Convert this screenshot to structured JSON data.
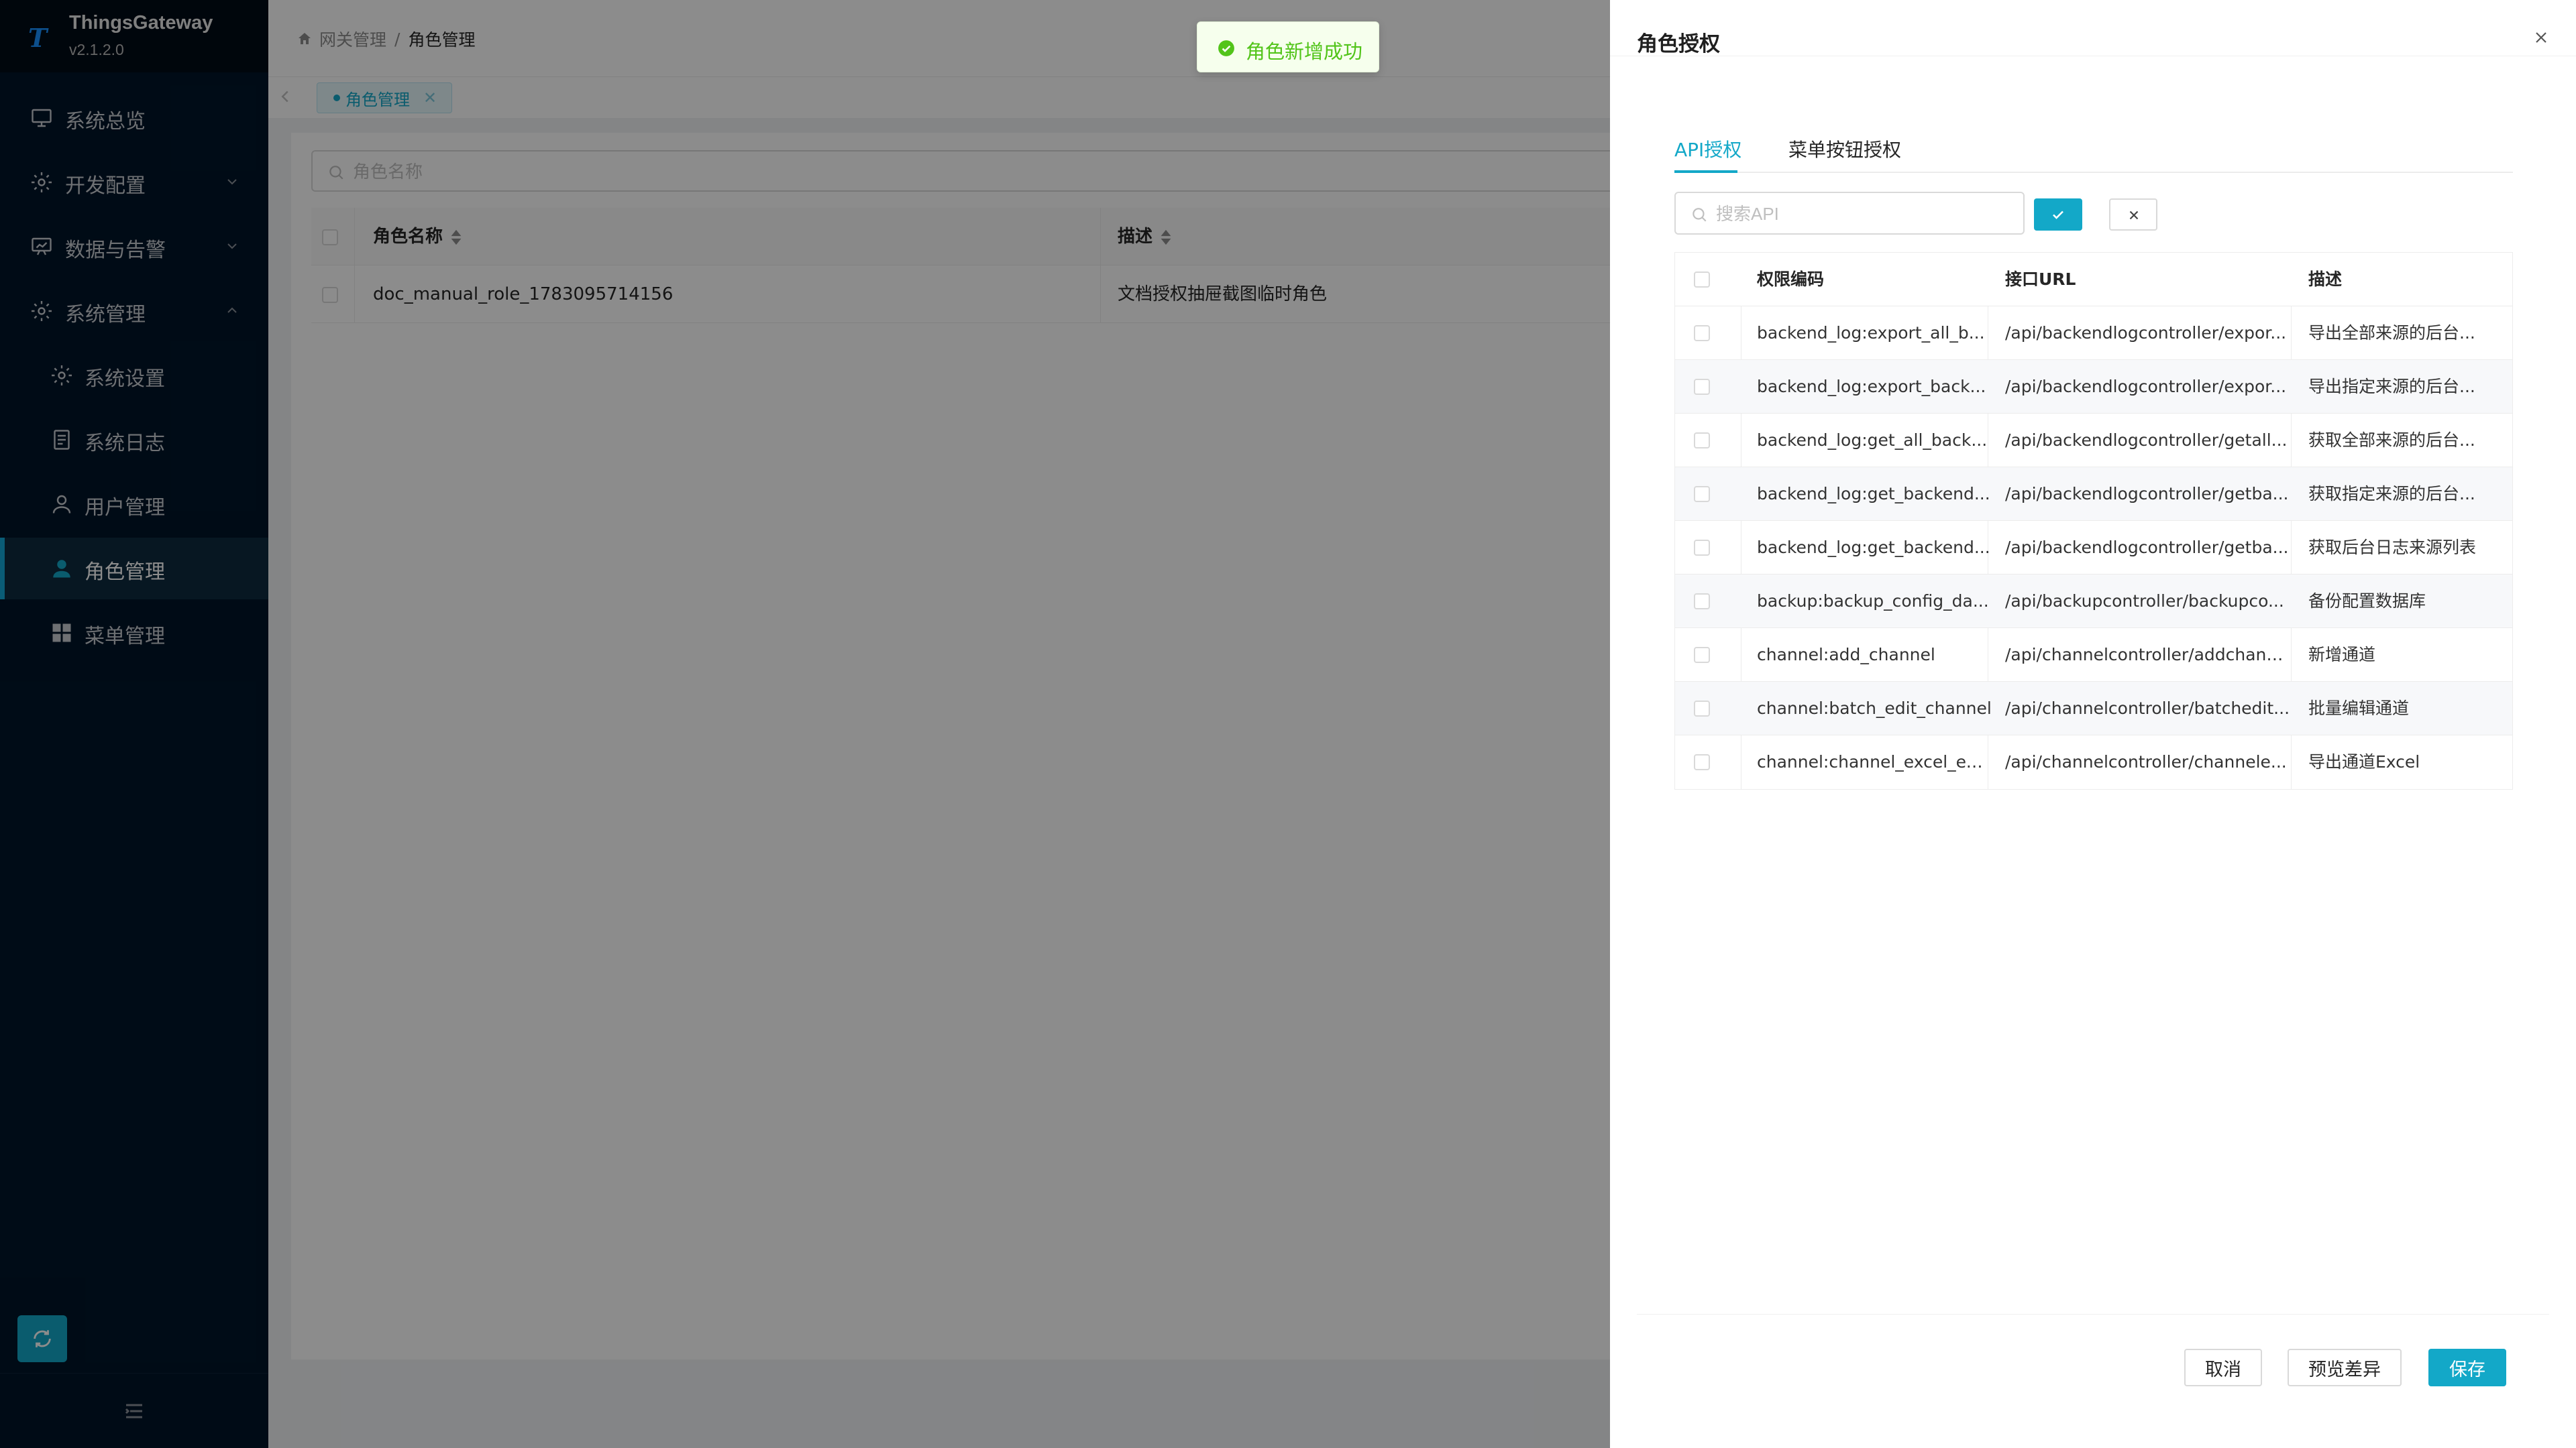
{
  "app": {
    "name": "ThingsGateway",
    "version": "v2.1.2.0",
    "logo_letter": "T"
  },
  "sidebar": {
    "items": [
      {
        "label": "系统总览",
        "icon": "monitor-icon"
      },
      {
        "label": "开发配置",
        "icon": "gear-icon",
        "expanded": false
      },
      {
        "label": "数据与告警",
        "icon": "chart-board-icon",
        "expanded": false
      },
      {
        "label": "系统管理",
        "icon": "gear-icon",
        "expanded": true
      },
      {
        "label": "系统设置",
        "icon": "gear-icon"
      },
      {
        "label": "系统日志",
        "icon": "document-icon"
      },
      {
        "label": "用户管理",
        "icon": "user-icon"
      },
      {
        "label": "角色管理",
        "icon": "user-filled-icon",
        "active": true
      },
      {
        "label": "菜单管理",
        "icon": "grid-icon"
      }
    ]
  },
  "breadcrumb": {
    "root": "网关管理",
    "separator": "/",
    "current": "角色管理"
  },
  "tabs": [
    {
      "label": "角色管理"
    }
  ],
  "role_page": {
    "search_placeholder": "角色名称",
    "columns": [
      "角色名称",
      "描述"
    ],
    "rows": [
      {
        "name": "doc_manual_role_1783095714156",
        "description": "文档授权抽屉截图临时角色"
      }
    ]
  },
  "toast": {
    "message": "角色新增成功",
    "type": "success"
  },
  "drawer": {
    "title": "角色授权",
    "tabs": [
      {
        "label": "API授权",
        "active": true
      },
      {
        "label": "菜单按钮授权",
        "active": false
      }
    ],
    "search_placeholder": "搜索API",
    "columns": [
      "权限编码",
      "接口URL",
      "描述"
    ],
    "rows": [
      {
        "code": "backend_log:export_all_b...",
        "url": "/api/backendlogcontroller/expor...",
        "desc": "导出全部来源的后台..."
      },
      {
        "code": "backend_log:export_back...",
        "url": "/api/backendlogcontroller/expor...",
        "desc": "导出指定来源的后台..."
      },
      {
        "code": "backend_log:get_all_back...",
        "url": "/api/backendlogcontroller/getall...",
        "desc": "获取全部来源的后台..."
      },
      {
        "code": "backend_log:get_backend...",
        "url": "/api/backendlogcontroller/getba...",
        "desc": "获取指定来源的后台..."
      },
      {
        "code": "backend_log:get_backend...",
        "url": "/api/backendlogcontroller/getba...",
        "desc": "获取后台日志来源列表"
      },
      {
        "code": "backup:backup_config_da...",
        "url": "/api/backupcontroller/backupco...",
        "desc": "备份配置数据库"
      },
      {
        "code": "channel:add_channel",
        "url": "/api/channelcontroller/addchannel",
        "desc": "新增通道"
      },
      {
        "code": "channel:batch_edit_channel",
        "url": "/api/channelcontroller/batchedit...",
        "desc": "批量编辑通道"
      },
      {
        "code": "channel:channel_excel_ex...",
        "url": "/api/channelcontroller/channele...",
        "desc": "导出通道Excel"
      }
    ],
    "footer": {
      "cancel": "取消",
      "preview_diff": "预览差异",
      "save": "保存"
    }
  },
  "colors": {
    "accent": "#13a8c8",
    "sidebar_bg": "#001529",
    "success": "#52c41a"
  }
}
